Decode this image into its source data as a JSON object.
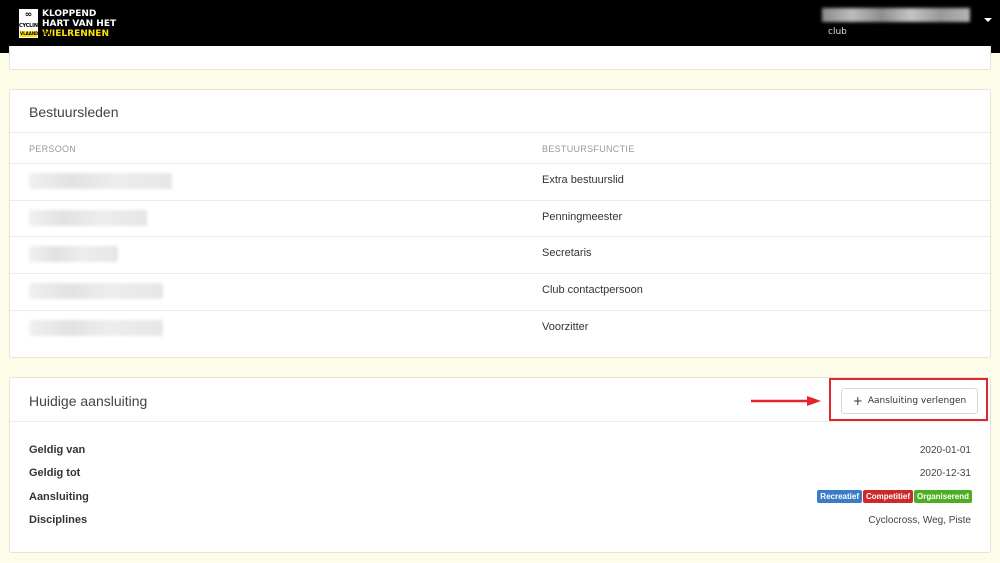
{
  "header": {
    "logo": {
      "line1": "KLOPPEND",
      "line2": "HART VAN HET",
      "line3": "WIELRENNEN",
      "mark_top": "∞",
      "mark_mid": "CYCLING",
      "mark_bottom": "VLAANDEREN"
    },
    "user_role": "club"
  },
  "board": {
    "title": "Bestuursleden",
    "columns": [
      "PERSOON",
      "BESTUURSFUNCTIE"
    ],
    "rows": [
      {
        "function": "Extra bestuurslid"
      },
      {
        "function": "Penningmeester"
      },
      {
        "function": "Secretaris"
      },
      {
        "function": "Club contactpersoon"
      },
      {
        "function": "Voorzitter"
      }
    ]
  },
  "affiliation": {
    "title": "Huidige aansluiting",
    "renew_label": "Aansluiting verlengen",
    "fields": [
      {
        "label": "Geldig van",
        "value": "2020-01-01"
      },
      {
        "label": "Geldig tot",
        "value": "2020-12-31"
      },
      {
        "label": "Aansluiting",
        "value": ""
      },
      {
        "label": "Disciplines",
        "value": "Cyclocross, Weg, Piste"
      }
    ],
    "badges": [
      {
        "text": "Recreatief",
        "color": "#3a7cc6"
      },
      {
        "text": "Competitief",
        "color": "#cc2a2a"
      },
      {
        "text": "Organiserend",
        "color": "#4caf22"
      }
    ]
  },
  "colors": {
    "header_bg": "#000000",
    "brand_yellow": "#ffe100",
    "highlight": "#e2262b",
    "page_bg": "#fcfce8"
  }
}
